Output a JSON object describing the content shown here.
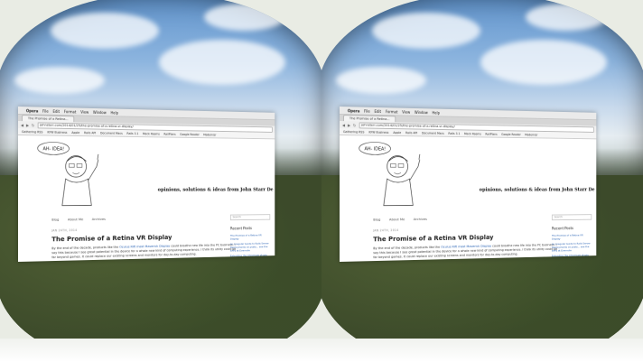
{
  "browser": {
    "menu": [
      "Opera",
      "File",
      "Edit",
      "Format",
      "View",
      "Window",
      "Help"
    ],
    "tab_title": "The Promise of a Retina...",
    "url": "johnsterr.com/2014/01/25/the-promise-of-a-retina-vr-display/",
    "bookmarks": [
      "Gathering RSS",
      "KFW Business",
      "Apple",
      "Rails API",
      "Document Macs",
      "Rails 3.1",
      "Mock Rooms",
      "RailPlans",
      "Google Reader",
      "Modernizr"
    ]
  },
  "blog": {
    "sketch_bubble": "AH- IDEA!",
    "tagline": "opinions, solutions & ideas from John Starr De",
    "nav": [
      "Blog",
      "About Me",
      "Archives"
    ],
    "search_placeholder": "Search",
    "post_date": "JAN 24TH, 2014",
    "post_title": "The Promise of a Retina VR Display",
    "post_body_pre": "By the end of the decade, products like the ",
    "post_body_link": "Oculus Rift most Maverick Display",
    "post_body_post": " could breathe new life into the PC business. I say this because I see great potential in the device for a whole new kind of computing experience. I think its utility could go far beyond games. It could replace our existing screens and monitors for day-to-day computing.",
    "sidebar_title": "Recent Posts",
    "recent_posts": [
      "The Promise of a Retina VR Display",
      "An Irregular Guide to Rails Server Deployments on posts... see the RFPs at Evernote",
      "Extending the Chromium plugin for better dev workflows"
    ]
  }
}
